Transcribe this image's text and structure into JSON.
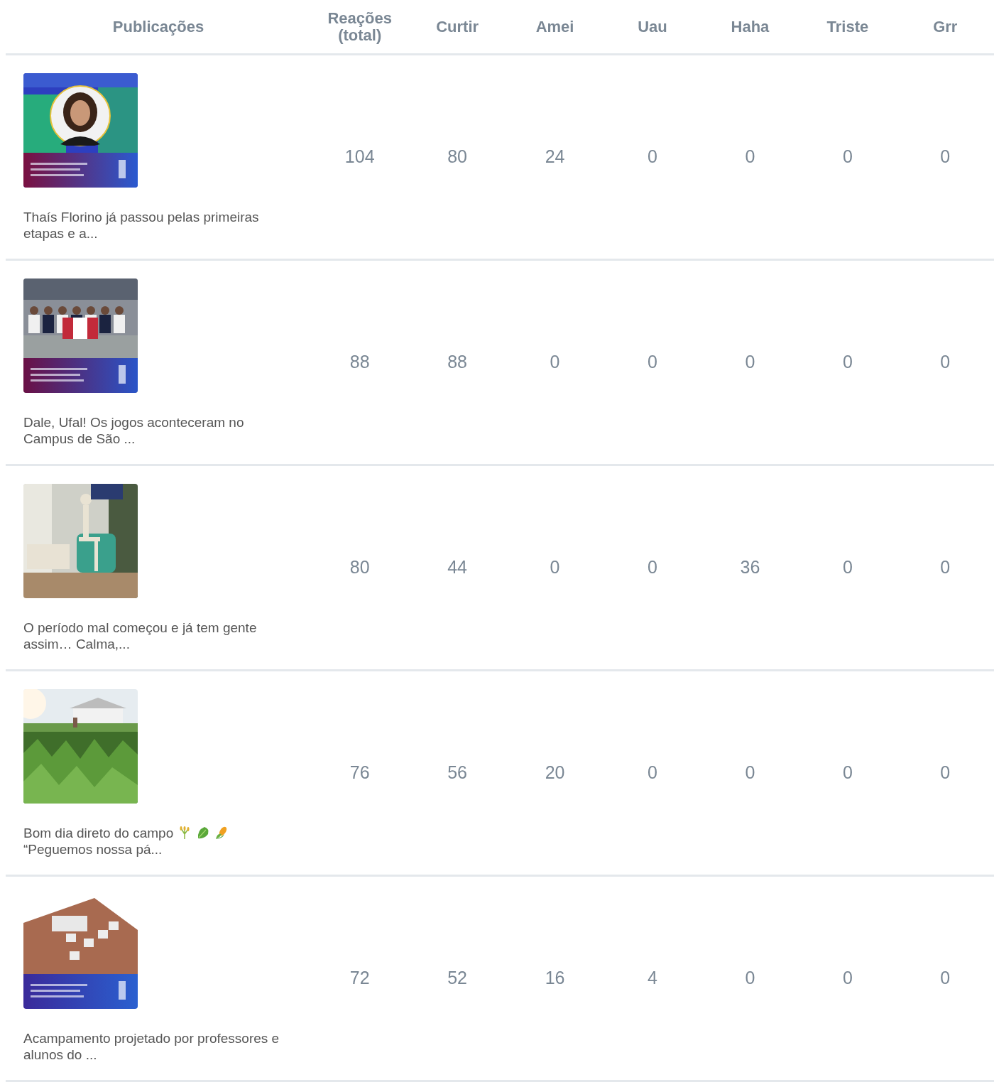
{
  "table": {
    "columns": [
      {
        "label": "Publicações"
      },
      {
        "label": "Reações (total)"
      },
      {
        "label": "Curtir"
      },
      {
        "label": "Amei"
      },
      {
        "label": "Uau"
      },
      {
        "label": "Haha"
      },
      {
        "label": "Triste"
      },
      {
        "label": "Grr"
      }
    ],
    "rows": [
      {
        "thumbnail": {
          "kind": "picture"
        },
        "caption": "Thaís Florino já passou pelas primeiras etapas e a...",
        "values": [
          "104",
          "80",
          "24",
          "0",
          "0",
          "0",
          "0"
        ]
      },
      {
        "thumbnail": {
          "kind": "picture"
        },
        "caption": "Dale, Ufal! Os jogos aconteceram no Campus de São ...",
        "values": [
          "88",
          "88",
          "0",
          "0",
          "0",
          "0",
          "0"
        ]
      },
      {
        "thumbnail": {
          "kind": "picture"
        },
        "caption": "O período mal começou e já tem gente assim… Calma,...",
        "values": [
          "80",
          "44",
          "0",
          "0",
          "36",
          "0",
          "0"
        ]
      },
      {
        "thumbnail": {
          "kind": "picture"
        },
        "caption": "Bom dia direto do campo",
        "caption_icons": [
          {
            "kind": "wheat"
          },
          {
            "kind": "lettuce"
          },
          {
            "kind": "corn"
          }
        ],
        "caption_cont": "“Peguemos nossa pá...",
        "values": [
          "76",
          "56",
          "20",
          "0",
          "0",
          "0",
          "0"
        ]
      },
      {
        "thumbnail": {
          "kind": "picture"
        },
        "caption": "Acampamento projetado por professores e alunos do ...",
        "values": [
          "72",
          "52",
          "16",
          "4",
          "0",
          "0",
          "0"
        ]
      }
    ]
  }
}
